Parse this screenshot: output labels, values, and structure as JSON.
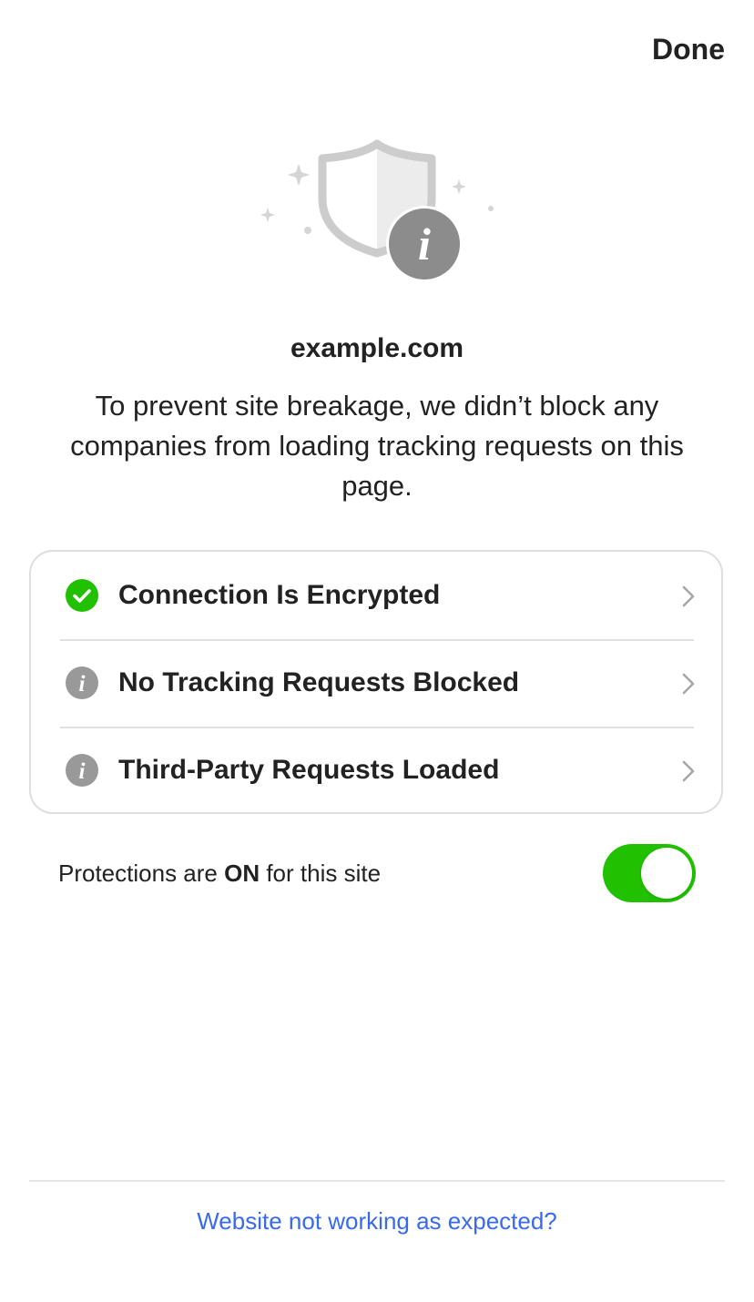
{
  "header": {
    "done_label": "Done"
  },
  "hero": {
    "icon": "shield-info-icon",
    "badge_glyph": "i"
  },
  "site": {
    "domain": "example.com",
    "description": "To prevent site breakage, we didn’t block any companies from loading tracking requests on this page."
  },
  "sections": [
    {
      "label": "Connection Is Encrypted",
      "icon": "check-circle-icon",
      "status_color": "#21c000"
    },
    {
      "label": "No Tracking Requests Blocked",
      "icon": "info-circle-icon",
      "status_color": "#999999"
    },
    {
      "label": "Third-Party Requests Loaded",
      "icon": "info-circle-icon",
      "status_color": "#999999"
    }
  ],
  "protections": {
    "prefix": "Protections are ",
    "state": "ON",
    "suffix": " for this site",
    "enabled": true,
    "toggle_color": "#21c000"
  },
  "footer": {
    "report_link": "Website not working as expected?",
    "link_color": "#3969ef"
  }
}
